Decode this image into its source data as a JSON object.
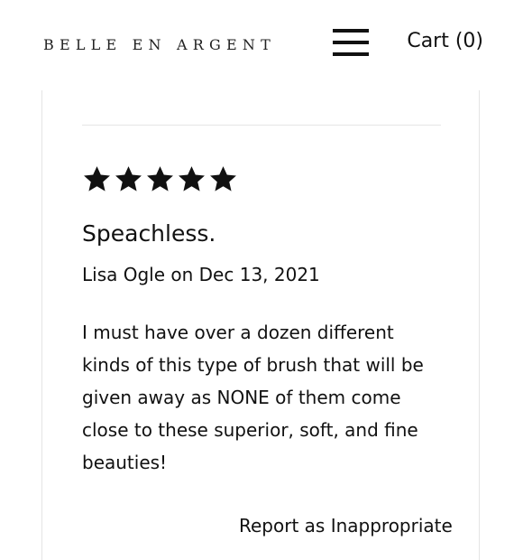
{
  "header": {
    "brand": "BELLE EN ARGENT",
    "menu_icon": "hamburger-menu-icon",
    "cart_label": "Cart (0)"
  },
  "review": {
    "rating": 5,
    "rating_max": 5,
    "star_icon": "star-icon",
    "title": "Speachless.",
    "author_date": "Lisa Ogle on Dec 13, 2021",
    "body": "I must have over a dozen different kinds of this type of brush that will be given away as NONE of them come close to these superior, soft, and fine beauties!"
  },
  "next_partial_text": "Report as Inappropriate",
  "colors": {
    "text": "#111111",
    "card_border": "#e4e4e4",
    "divider": "#e6e6e6",
    "background": "#ffffff"
  }
}
